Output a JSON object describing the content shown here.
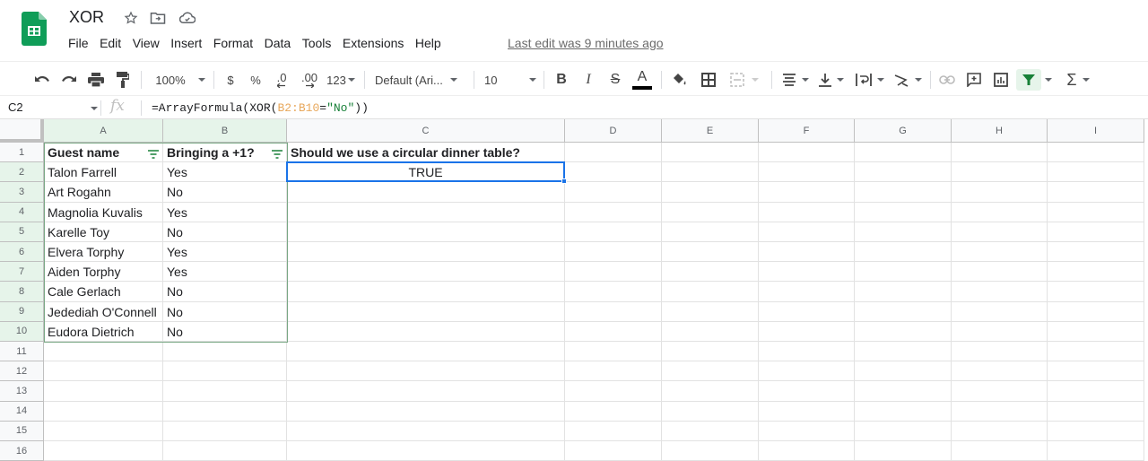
{
  "app": {
    "doc_title": "XOR",
    "title_icons": [
      "star-icon",
      "move-to-folder-icon",
      "cloud-saved-icon"
    ],
    "menu": [
      "File",
      "Edit",
      "View",
      "Insert",
      "Format",
      "Data",
      "Tools",
      "Extensions",
      "Help"
    ],
    "last_edit": "Last edit was 9 minutes ago",
    "brand_color": "#0f9d58"
  },
  "toolbar": {
    "zoom": "100%",
    "currency": "$",
    "percent": "%",
    "decrease_decimal": ".0",
    "increase_decimal": ".00",
    "more_formats": "123",
    "font": "Default (Ari...",
    "font_size": "10",
    "bold": "B",
    "italic": "I",
    "strikethrough": "S",
    "text_color": "A",
    "sum": "Σ"
  },
  "formula_bar": {
    "name_box": "C2",
    "fx": "fx",
    "formula_prefix": "=ArrayFormula(XOR(",
    "formula_ref": "B2:B10",
    "formula_mid": "=",
    "formula_str": "\"No\"",
    "formula_suffix": "))"
  },
  "sheet": {
    "columns": [
      "A",
      "B",
      "C",
      "D",
      "E",
      "F",
      "G",
      "H",
      "I"
    ],
    "rows": [
      "1",
      "2",
      "3",
      "4",
      "5",
      "6",
      "7",
      "8",
      "9",
      "10",
      "11",
      "12",
      "13",
      "14",
      "15",
      "16"
    ],
    "headers": {
      "a1": "Guest name",
      "b1": "Bringing a +1?",
      "c1": "Should we use a circular dinner table?"
    },
    "guests": [
      {
        "name": "Talon Farrell",
        "plus_one": "Yes"
      },
      {
        "name": "Art Rogahn",
        "plus_one": "No"
      },
      {
        "name": "Magnolia Kuvalis",
        "plus_one": "Yes"
      },
      {
        "name": "Karelle Toy",
        "plus_one": "No"
      },
      {
        "name": "Elvera Torphy",
        "plus_one": "Yes"
      },
      {
        "name": "Aiden Torphy",
        "plus_one": "Yes"
      },
      {
        "name": "Cale Gerlach",
        "plus_one": "No"
      },
      {
        "name": "Jedediah O'Connell",
        "plus_one": "No"
      },
      {
        "name": "Eudora Dietrich",
        "plus_one": "No"
      }
    ],
    "c2": "TRUE",
    "selected_cell": "C2",
    "selection_color": "#1a73e8",
    "filter_range_color": "#79a884"
  }
}
